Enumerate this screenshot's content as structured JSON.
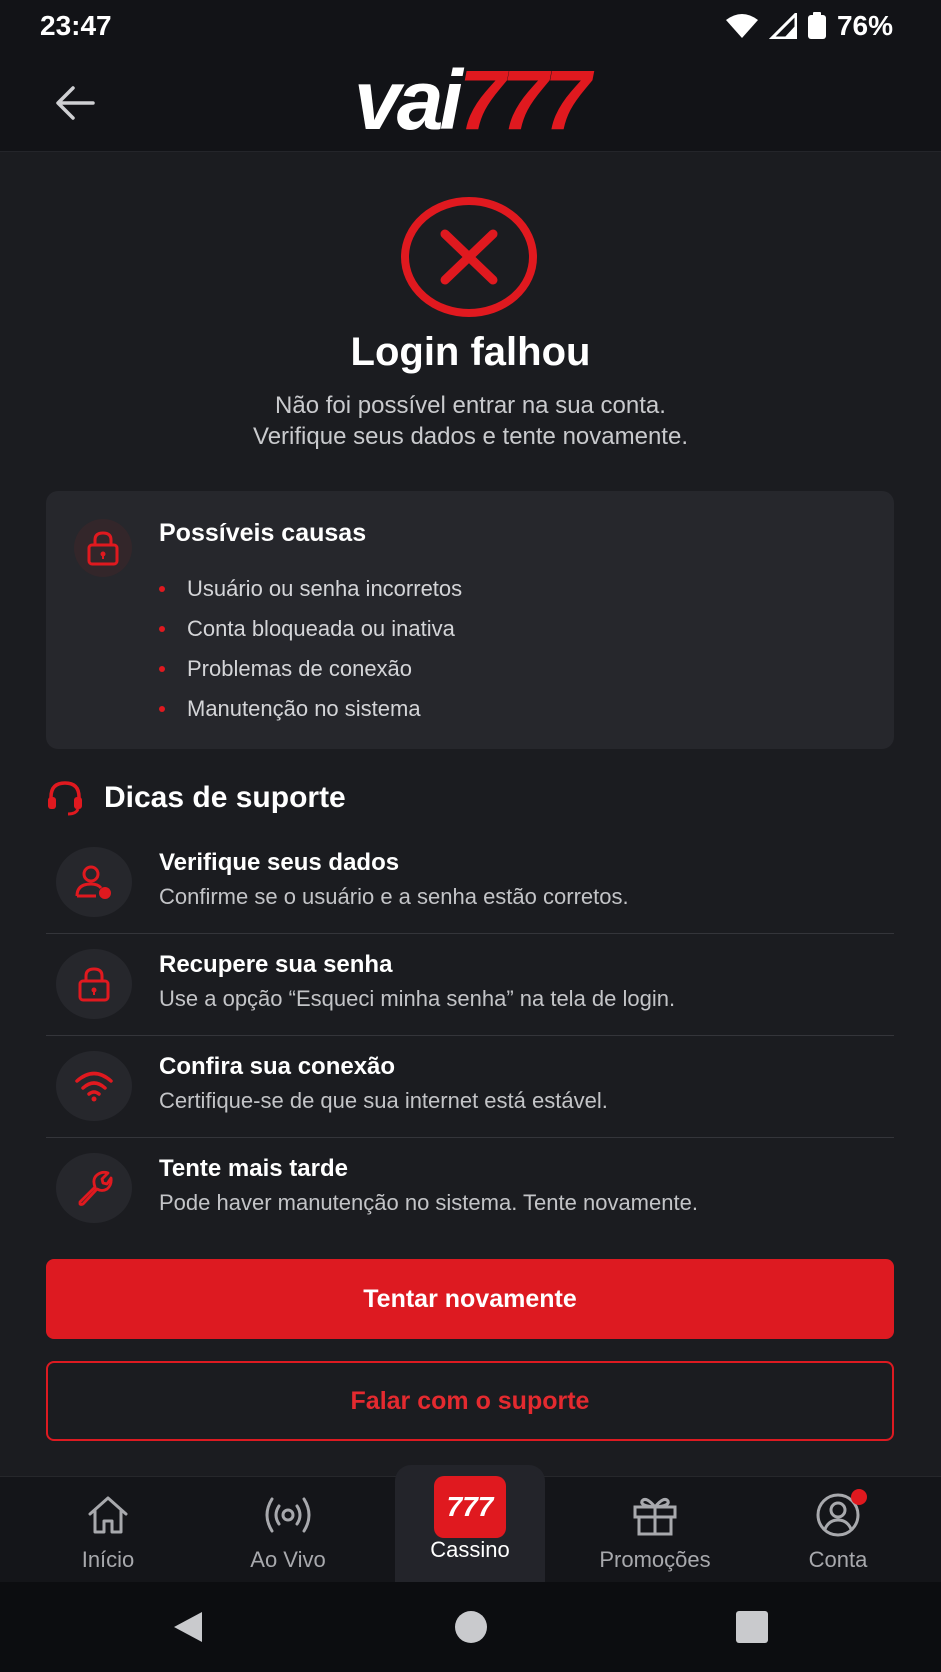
{
  "status_bar": {
    "time": "23:47",
    "battery": "76%"
  },
  "header": {
    "logo_part1": "vai",
    "logo_part2": "777",
    "back_icon": "arrow-left-icon"
  },
  "error": {
    "icon": "error-x-circle-icon",
    "title": "Login falhou",
    "subtitle_line1": "Não foi possível entrar na sua conta.",
    "subtitle_line2": "Verifique seus dados e tente novamente."
  },
  "causes": {
    "title": "Possíveis causas",
    "icon": "lock-icon",
    "items": [
      "Usuário ou senha incorretos",
      "Conta bloqueada ou inativa",
      "Problemas de conexão",
      "Manutenção no sistema"
    ]
  },
  "support": {
    "title": "Dicas de suporte",
    "icon": "headset-icon",
    "tips": [
      {
        "icon": "user-icon",
        "title": "Verifique seus dados",
        "desc": "Confirme se o usuário e a senha estão corretos."
      },
      {
        "icon": "lock-icon",
        "title": "Recupere sua senha",
        "desc": "Use a opção “Esqueci minha senha” na tela de login."
      },
      {
        "icon": "wifi-icon",
        "title": "Confira sua conexão",
        "desc": "Certifique-se de que sua internet está estável."
      },
      {
        "icon": "wrench-icon",
        "title": "Tente mais tarde",
        "desc": "Pode haver manutenção no sistema. Tente novamente."
      }
    ]
  },
  "actions": {
    "retry_label": "Tentar novamente",
    "support_label": "Falar com o suporte"
  },
  "bottom_nav": {
    "items": [
      {
        "label": "Início",
        "icon": "home-icon"
      },
      {
        "label": "Ao Vivo",
        "icon": "live-broadcast-icon"
      },
      {
        "label": "Cassino",
        "icon": "777-badge-icon",
        "badge_text": "777",
        "active": true
      },
      {
        "label": "Promoções",
        "icon": "gift-icon"
      },
      {
        "label": "Conta",
        "icon": "account-icon",
        "has_notification": true
      }
    ]
  },
  "colors": {
    "accent": "#e0191f",
    "background": "#1b1c20",
    "card": "#26272c"
  }
}
